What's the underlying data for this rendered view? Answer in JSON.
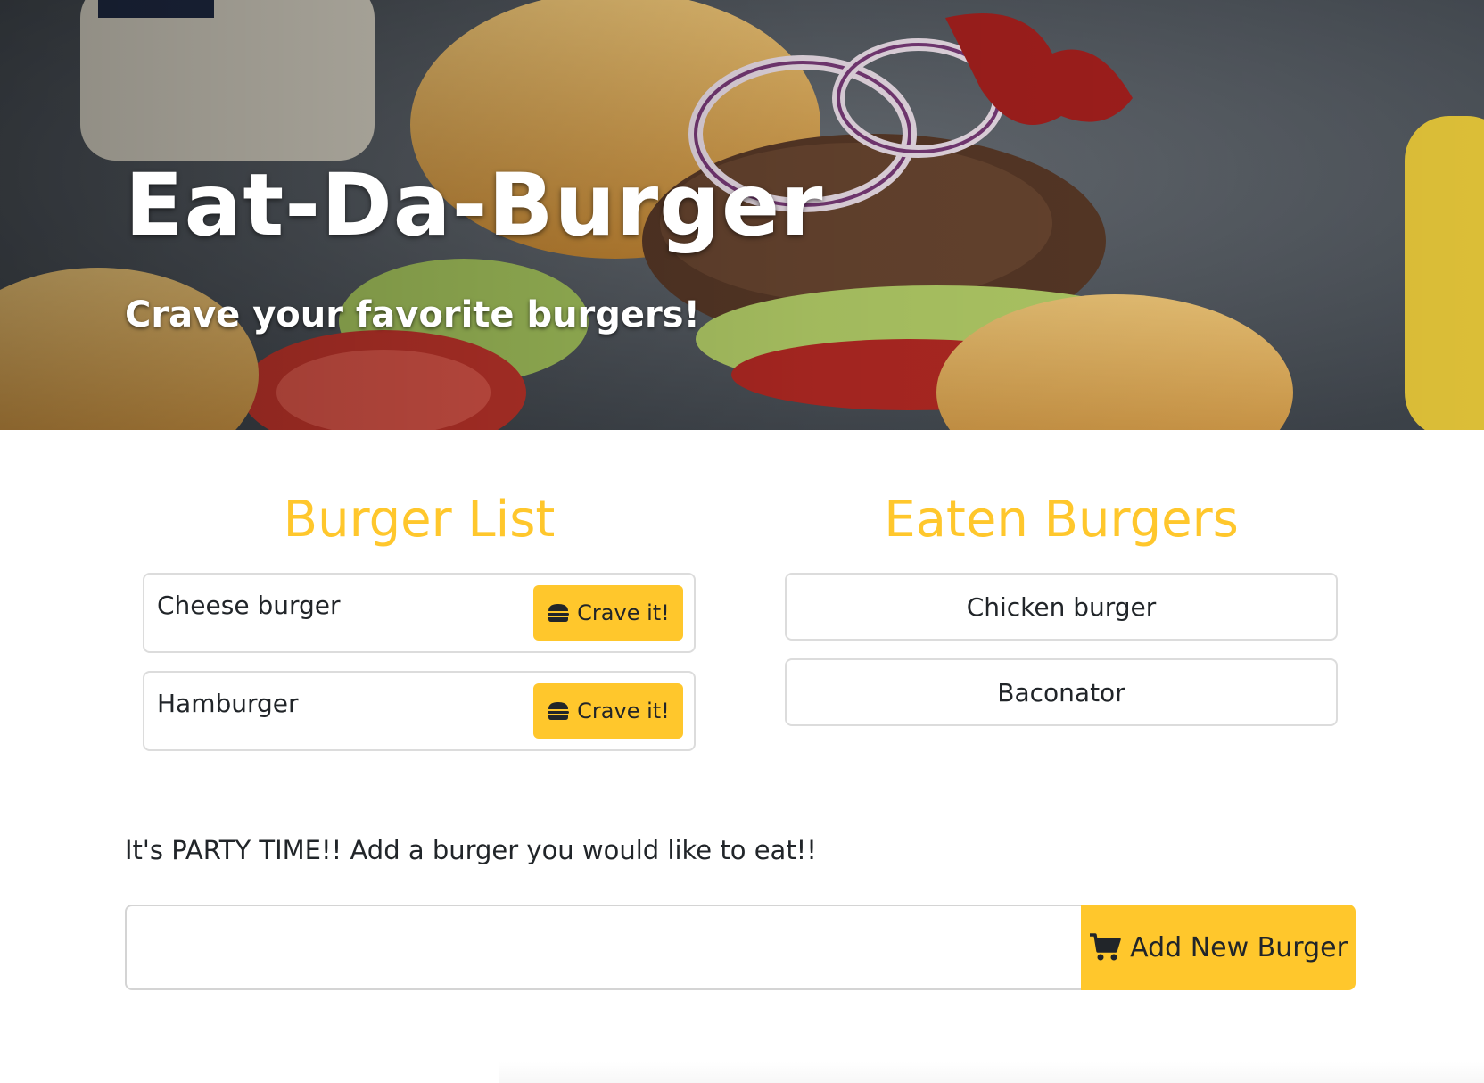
{
  "hero": {
    "title": "Eat-Da-Burger",
    "subtitle": "Crave your favorite burgers!"
  },
  "burger_list": {
    "heading": "Burger List",
    "items": [
      {
        "name": "Cheese burger",
        "button_label": "Crave it!",
        "icon": "hamburger-icon"
      },
      {
        "name": "Hamburger",
        "button_label": "Crave it!",
        "icon": "hamburger-icon"
      }
    ]
  },
  "eaten_burgers": {
    "heading": "Eaten Burgers",
    "items": [
      {
        "name": "Chicken burger"
      },
      {
        "name": "Baconator"
      }
    ]
  },
  "add_form": {
    "label": "It's PARTY TIME!! Add a burger you would like to eat!!",
    "input_value": "",
    "input_placeholder": "",
    "button_label": "Add New Burger",
    "button_icon": "shopping-cart-icon"
  },
  "colors": {
    "accent": "#ffc72c",
    "text": "#212529",
    "card_border": "#dcdcdc"
  }
}
